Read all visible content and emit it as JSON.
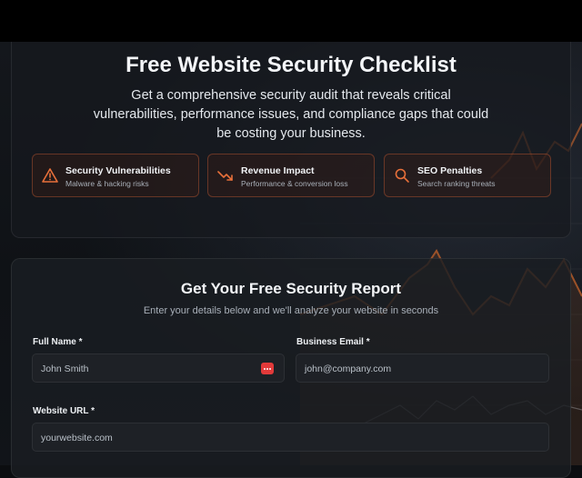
{
  "hero": {
    "title": "Free Website Security Checklist",
    "subtitle": "Get a comprehensive security audit that reveals critical vulnerabilities, performance issues, and compliance gaps that could be costing your business."
  },
  "features": [
    {
      "title": "Security Vulnerabilities",
      "subtitle": "Malware & hacking risks",
      "icon": "warning-triangle-icon"
    },
    {
      "title": "Revenue Impact",
      "subtitle": "Performance & conversion loss",
      "icon": "trending-down-icon"
    },
    {
      "title": "SEO Penalties",
      "subtitle": "Search ranking threats",
      "icon": "search-icon"
    }
  ],
  "form": {
    "title": "Get Your Free Security Report",
    "subtitle": "Enter your details below and we'll analyze your website in seconds",
    "full_name": {
      "label": "Full Name *",
      "value": "John Smith"
    },
    "email": {
      "label": "Business Email *",
      "value": "john@company.com"
    },
    "website": {
      "label": "Website URL *",
      "value": "yourwebsite.com"
    }
  },
  "colors": {
    "accent": "#e8703a",
    "background": "#0f1216",
    "card": "#1a1d22"
  }
}
